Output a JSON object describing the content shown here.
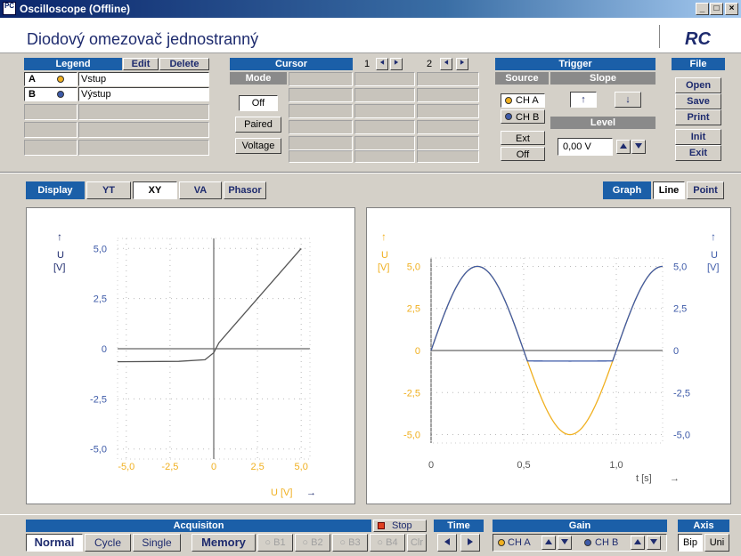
{
  "window": {
    "title": "Oscilloscope (Offline)",
    "icon_text": "PC",
    "minimize": "_",
    "maximize": "□",
    "close": "×"
  },
  "header": {
    "experiment_title": "Diodový omezovač jednostranný",
    "logo": "RC"
  },
  "legend": {
    "title": "Legend",
    "edit": "Edit",
    "delete": "Delete",
    "rows": [
      {
        "letter": "A",
        "label": "Vstup",
        "color": "#f0b020"
      },
      {
        "letter": "B",
        "label": "Výstup",
        "color": "#3d5aa8"
      }
    ]
  },
  "cursor": {
    "title": "Cursor",
    "mode": "Mode",
    "off": "Off",
    "paired": "Paired",
    "voltage": "Voltage",
    "c1": "1",
    "c2": "2"
  },
  "trigger": {
    "title": "Trigger",
    "source": "Source",
    "slope": "Slope",
    "level": "Level",
    "cha": "CH A",
    "chb": "CH B",
    "ext": "Ext",
    "off": "Off",
    "level_value": "0,00 V",
    "slope_up": "↑",
    "slope_down": "↓"
  },
  "file": {
    "title": "File",
    "open": "Open",
    "save": "Save",
    "print": "Print",
    "init": "Init",
    "exit": "Exit"
  },
  "display": {
    "label": "Display",
    "tabs": [
      "YT",
      "XY",
      "VA",
      "Phasor"
    ],
    "selected": "XY"
  },
  "graph": {
    "label": "Graph",
    "line": "Line",
    "point": "Point"
  },
  "xy_plot": {
    "y_arrow": "↑",
    "y_unit_symbol": "U",
    "y_unit": "[V]",
    "x_label": "U [V]",
    "x_arrow": "→",
    "y_ticks": [
      "5,0",
      "2,5",
      "0",
      "-2,5",
      "-5,0"
    ],
    "x_ticks": [
      "-5,0",
      "-2,5",
      "0",
      "2,5",
      "5,0"
    ]
  },
  "yt_plot": {
    "y_arrow": "↑",
    "y_unit_symbol": "U",
    "y_unit": "[V]",
    "x_label": "t [s]",
    "x_arrow": "→",
    "y_ticks": [
      "5,0",
      "2,5",
      "0",
      "-2,5",
      "-5,0"
    ],
    "x_ticks": [
      "0",
      "0,5",
      "1,0"
    ]
  },
  "chart_data": [
    {
      "type": "line",
      "title": "",
      "xlabel": "U [V]",
      "ylabel": "U [V]",
      "xlim": [
        -5.5,
        5.5
      ],
      "ylim": [
        -5.5,
        5.5
      ],
      "series": [
        {
          "name": "",
          "x": [
            -5.5,
            -2.0,
            -0.5,
            0.0,
            0.3,
            5.0
          ],
          "y": [
            -0.65,
            -0.63,
            -0.55,
            -0.2,
            0.3,
            5.0
          ]
        }
      ]
    },
    {
      "type": "line",
      "title": "",
      "xlabel": "t [s]",
      "ylabel": "U [V]",
      "xlim": [
        0,
        1.25
      ],
      "ylim": [
        -5.5,
        5.5
      ],
      "series": [
        {
          "name": "Vstup",
          "x": [
            0,
            0.125,
            0.25,
            0.375,
            0.5,
            0.625,
            0.75,
            0.875,
            1.0,
            1.125,
            1.25
          ],
          "y": [
            0,
            3.54,
            5.0,
            3.54,
            0,
            -3.54,
            -5.0,
            -3.54,
            0,
            3.54,
            5.0
          ]
        },
        {
          "name": "Výstup",
          "x": [
            0,
            0.125,
            0.25,
            0.375,
            0.5,
            0.52,
            0.625,
            0.75,
            0.875,
            0.98,
            1.0,
            1.125,
            1.25
          ],
          "y": [
            0,
            3.54,
            5.0,
            3.54,
            0,
            -0.6,
            -0.62,
            -0.63,
            -0.62,
            -0.6,
            0,
            3.54,
            5.0
          ]
        }
      ]
    }
  ],
  "acquisition": {
    "title": "Acquisiton",
    "stop": "Stop",
    "normal": "Normal",
    "cycle": "Cycle",
    "single": "Single",
    "memory": "Memory",
    "b1": "B1",
    "b2": "B2",
    "b3": "B3",
    "b4": "B4",
    "clr": "Clr"
  },
  "time": {
    "title": "Time"
  },
  "gain": {
    "title": "Gain",
    "cha": "CH A",
    "chb": "CH B"
  },
  "axis": {
    "title": "Axis",
    "bip": "Bip",
    "uni": "Uni"
  },
  "colors": {
    "accent": "#1b5fa8",
    "ch_a": "#f0b020",
    "ch_b": "#3d5aa8",
    "xy_line": "#555555"
  }
}
